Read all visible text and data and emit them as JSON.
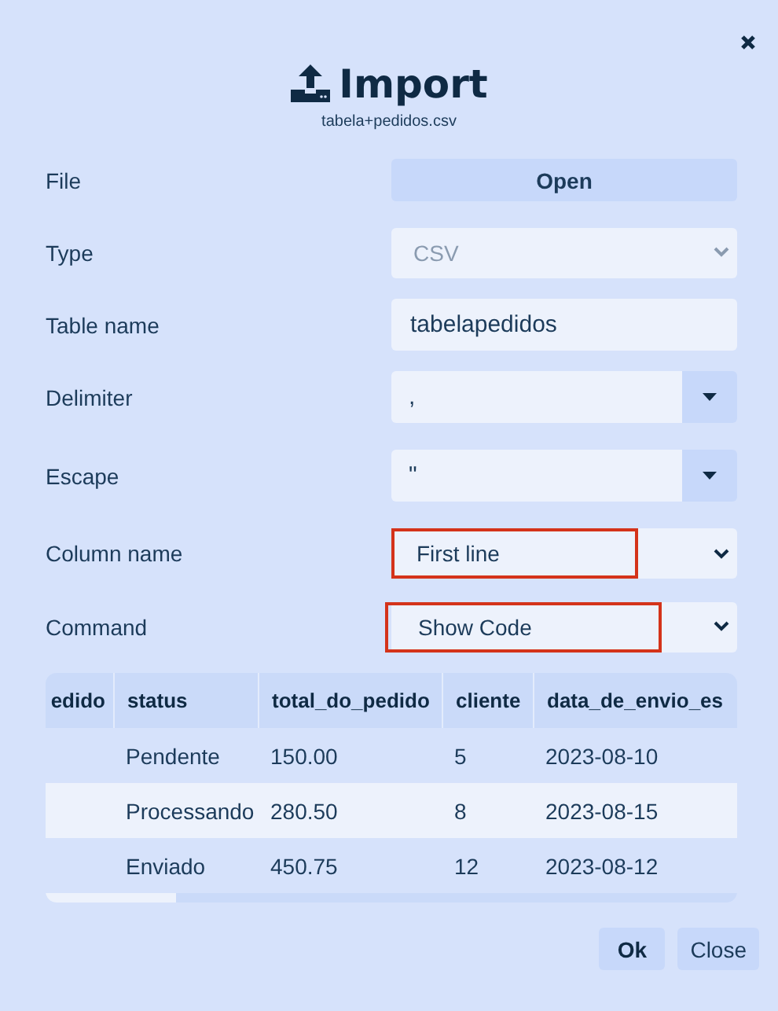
{
  "dialog": {
    "title": "Import",
    "filename": "tabela+pedidos.csv"
  },
  "fields": [
    {
      "kind": "button",
      "label": "File",
      "value": "Open"
    },
    {
      "kind": "select",
      "label": "Type",
      "value": "CSV",
      "disabled": true,
      "highlighted": false
    },
    {
      "kind": "text",
      "label": "Table name",
      "value": "tabelapedidos"
    },
    {
      "kind": "combo",
      "label": "Delimiter",
      "value": ","
    },
    {
      "kind": "combo",
      "label": "Escape",
      "value": "\""
    },
    {
      "kind": "select",
      "label": "Column name",
      "value": "First line",
      "disabled": false,
      "highlighted": true
    },
    {
      "kind": "select",
      "label": "Command",
      "value": "Show Code",
      "disabled": false,
      "highlighted": true
    }
  ],
  "table": {
    "columns": [
      "edido",
      "status",
      "total_do_pedido",
      "cliente",
      "data_de_envio_es"
    ],
    "rows": [
      {
        "cells": [
          "",
          "Pendente",
          "150.00",
          "5",
          "2023-08-10"
        ],
        "selected": false
      },
      {
        "cells": [
          "",
          "Processando",
          "280.50",
          "8",
          "2023-08-15"
        ],
        "selected": true
      },
      {
        "cells": [
          "",
          "Enviado",
          "450.75",
          "12",
          "2023-08-12"
        ],
        "selected": false
      }
    ]
  },
  "buttons": [
    "Ok",
    "Close"
  ]
}
